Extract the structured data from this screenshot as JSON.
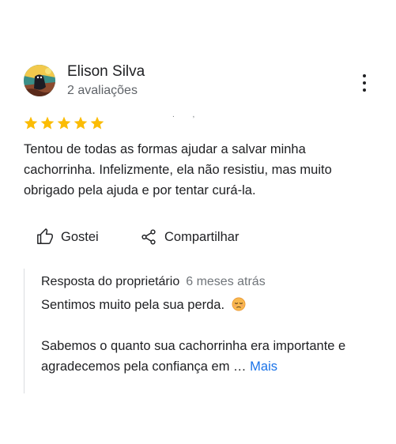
{
  "review": {
    "author": "Elison Silva",
    "author_meta": "2 avaliações",
    "rating": 5,
    "time_stub": ". ,",
    "text": "Tentou de todas as formas ajudar a salvar minha cachorrinha. Infelizmente, ela não resistiu, mas muito obrigado pela ajuda e por tentar curá-la."
  },
  "actions": {
    "like_label": "Gostei",
    "share_label": "Compartilhar"
  },
  "owner_reply": {
    "label": "Resposta do proprietário",
    "time": "6 meses atrás",
    "line1": "Sentimos muito pela sua perda.",
    "line2": "Sabemos o quanto sua cachorrinha era importante e agradecemos pela confiança em …",
    "more_label": "Mais",
    "emoji": "pensive-face-icon"
  },
  "colors": {
    "star": "#fbbc04",
    "link": "#1a73e8",
    "secondary_text": "#5f6368",
    "divider": "#dadce0"
  }
}
